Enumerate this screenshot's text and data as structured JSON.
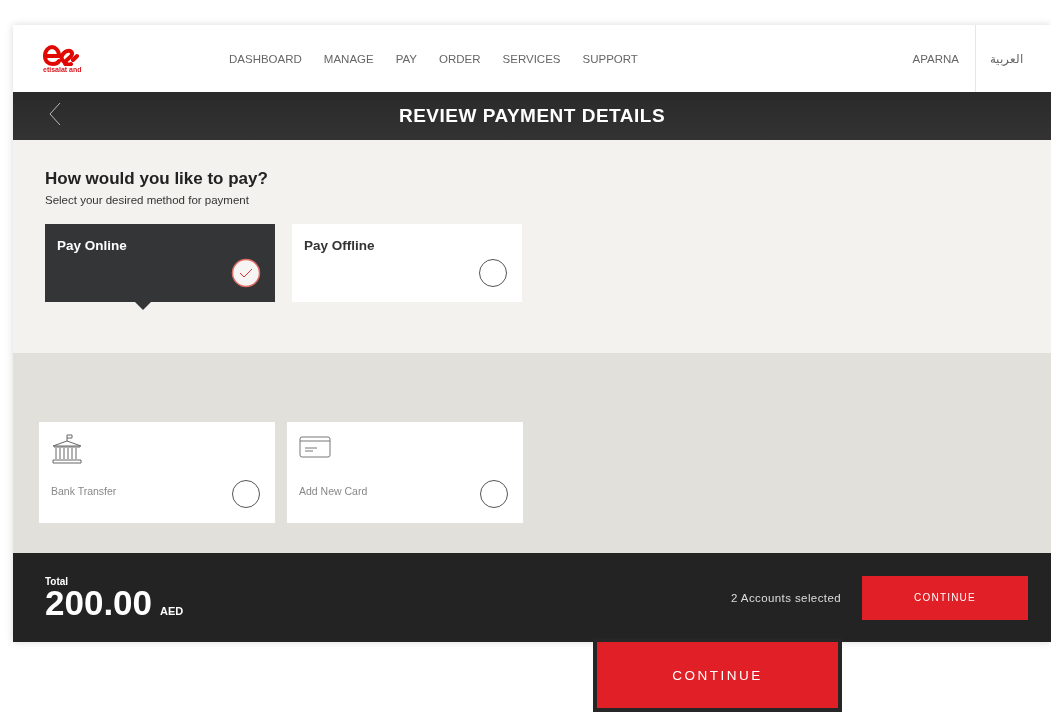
{
  "header": {
    "logo_text": "etisalat and",
    "nav": [
      {
        "label": "DASHBOARD"
      },
      {
        "label": "MANAGE"
      },
      {
        "label": "PAY"
      },
      {
        "label": "ORDER"
      },
      {
        "label": "SERVICES"
      },
      {
        "label": "SUPPORT"
      }
    ],
    "user": "APARNA",
    "language": "العربية"
  },
  "title_bar": {
    "title": "REVIEW PAYMENT DETAILS"
  },
  "question": {
    "heading": "How would you like to pay?",
    "subtitle": "Select your desired method for payment"
  },
  "pay_modes": [
    {
      "label": "Pay Online",
      "selected": true
    },
    {
      "label": "Pay Offline",
      "selected": false
    }
  ],
  "methods": [
    {
      "kind": "bank",
      "label": "Bank Transfer",
      "selected": false
    },
    {
      "kind": "card",
      "label": "Add New Card",
      "selected": false
    }
  ],
  "footer": {
    "total_label": "Total",
    "amount": "200.00",
    "currency": "AED",
    "accounts": "2 Accounts selected",
    "button": "CONTINUE"
  },
  "callout": {
    "button": "CONTINUE"
  }
}
